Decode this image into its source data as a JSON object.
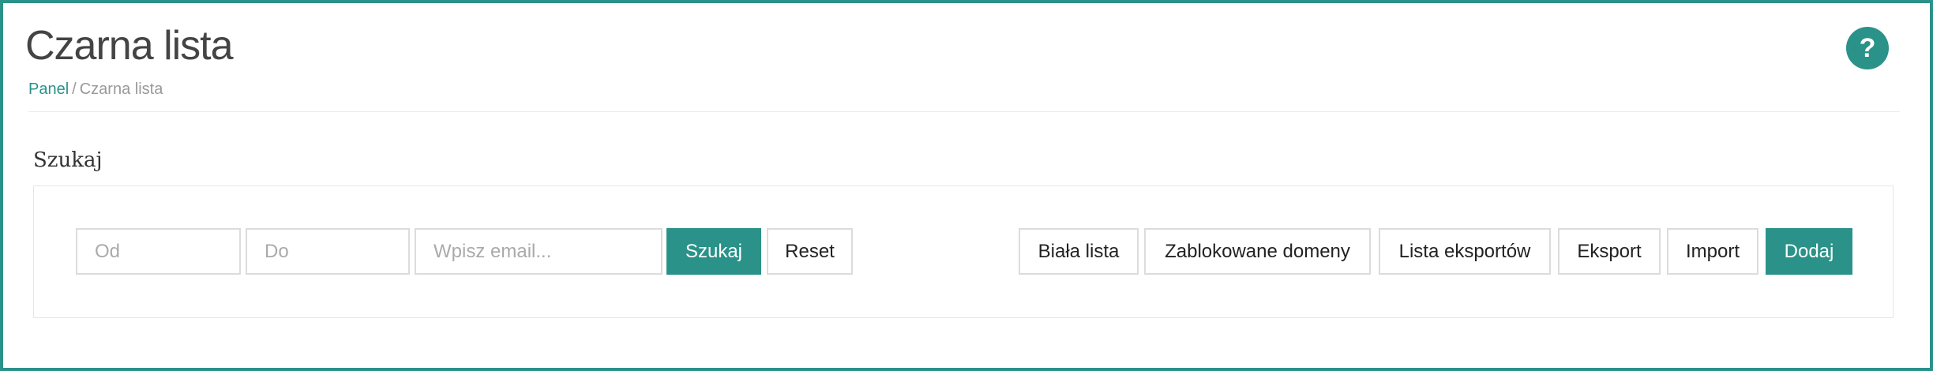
{
  "header": {
    "title": "Czarna lista",
    "breadcrumb": {
      "link": "Panel",
      "separator": "/",
      "current": "Czarna lista"
    },
    "help_icon": "question-icon",
    "help_glyph": "?"
  },
  "search": {
    "title": "Szukaj",
    "from_placeholder": "Od",
    "to_placeholder": "Do",
    "email_placeholder": "Wpisz email...",
    "search_label": "Szukaj",
    "reset_label": "Reset"
  },
  "actions": {
    "whitelist_label": "Biała lista",
    "blocked_domains_label": "Zablokowane domeny",
    "exports_list_label": "Lista eksportów",
    "export_label": "Eksport",
    "import_label": "Import",
    "add_label": "Dodaj"
  },
  "colors": {
    "accent": "#2a9289",
    "border": "#dcdcdc"
  }
}
